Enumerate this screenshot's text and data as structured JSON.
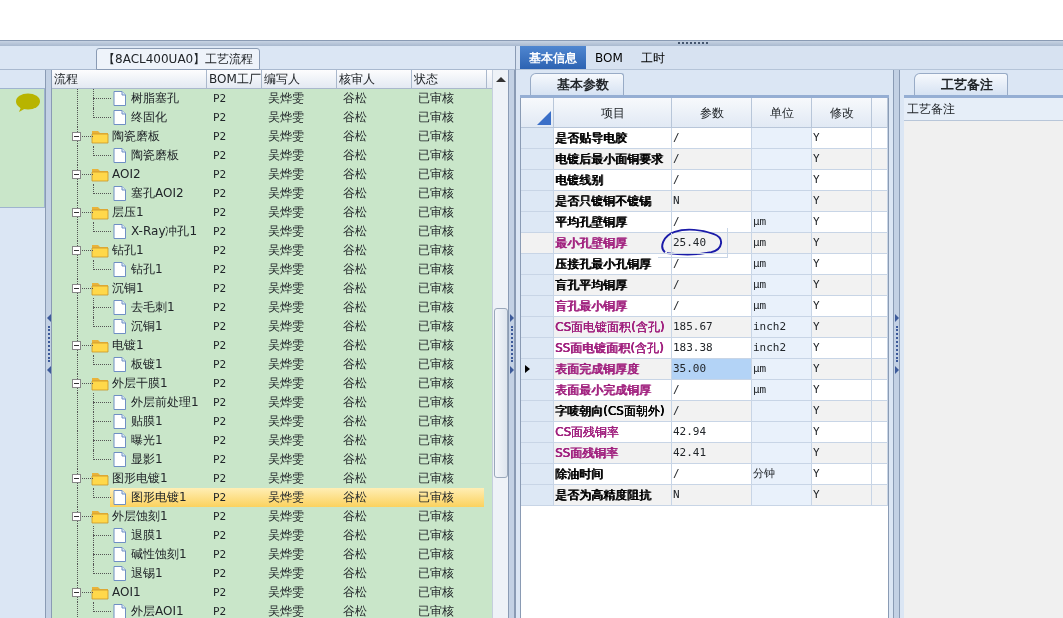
{
  "left_panel": {
    "title": "【8ACL400UA0】工艺流程",
    "columns": [
      "流程",
      "BOM工厂",
      "编写人",
      "核审人",
      "状态"
    ],
    "tree": [
      {
        "children": [
          {
            "name": "树脂塞孔",
            "factory": "P2",
            "author": "吴烨雯",
            "reviewer": "谷松",
            "status": "已审核",
            "selected": false
          },
          {
            "name": "终固化",
            "factory": "P2",
            "author": "吴烨雯",
            "reviewer": "谷松",
            "status": "已审核",
            "selected": false
          }
        ]
      },
      {
        "name": "陶瓷磨板",
        "factory": "P2",
        "author": "吴烨雯",
        "reviewer": "谷松",
        "status": "已审核",
        "selected": false,
        "expanded": true,
        "children": [
          {
            "name": "陶瓷磨板",
            "factory": "P2",
            "author": "吴烨雯",
            "reviewer": "谷松",
            "status": "已审核",
            "selected": false
          }
        ]
      },
      {
        "name": "AOI2",
        "factory": "P2",
        "author": "吴烨雯",
        "reviewer": "谷松",
        "status": "已审核",
        "selected": false,
        "expanded": true,
        "children": [
          {
            "name": "塞孔AOI2",
            "factory": "P2",
            "author": "吴烨雯",
            "reviewer": "谷松",
            "status": "已审核",
            "selected": false
          }
        ]
      },
      {
        "name": "层压1",
        "factory": "P2",
        "author": "吴烨雯",
        "reviewer": "谷松",
        "status": "已审核",
        "selected": false,
        "expanded": true,
        "children": [
          {
            "name": "X-Ray冲孔1",
            "factory": "P2",
            "author": "吴烨雯",
            "reviewer": "谷松",
            "status": "已审核",
            "selected": false
          }
        ]
      },
      {
        "name": "钻孔1",
        "factory": "P2",
        "author": "吴烨雯",
        "reviewer": "谷松",
        "status": "已审核",
        "selected": false,
        "expanded": true,
        "children": [
          {
            "name": "钻孔1",
            "factory": "P2",
            "author": "吴烨雯",
            "reviewer": "谷松",
            "status": "已审核",
            "selected": false
          }
        ]
      },
      {
        "name": "沉铜1",
        "factory": "P2",
        "author": "吴烨雯",
        "reviewer": "谷松",
        "status": "已审核",
        "selected": false,
        "expanded": true,
        "children": [
          {
            "name": "去毛刺1",
            "factory": "P2",
            "author": "吴烨雯",
            "reviewer": "谷松",
            "status": "已审核",
            "selected": false
          },
          {
            "name": "沉铜1",
            "factory": "P2",
            "author": "吴烨雯",
            "reviewer": "谷松",
            "status": "已审核",
            "selected": false
          }
        ]
      },
      {
        "name": "电镀1",
        "factory": "P2",
        "author": "吴烨雯",
        "reviewer": "谷松",
        "status": "已审核",
        "selected": false,
        "expanded": true,
        "children": [
          {
            "name": "板镀1",
            "factory": "P2",
            "author": "吴烨雯",
            "reviewer": "谷松",
            "status": "已审核",
            "selected": false
          }
        ]
      },
      {
        "name": "外层干膜1",
        "factory": "P2",
        "author": "吴烨雯",
        "reviewer": "谷松",
        "status": "已审核",
        "selected": false,
        "expanded": true,
        "children": [
          {
            "name": "外层前处理1",
            "factory": "P2",
            "author": "吴烨雯",
            "reviewer": "谷松",
            "status": "已审核",
            "selected": false
          },
          {
            "name": "贴膜1",
            "factory": "P2",
            "author": "吴烨雯",
            "reviewer": "谷松",
            "status": "已审核",
            "selected": false
          },
          {
            "name": "曝光1",
            "factory": "P2",
            "author": "吴烨雯",
            "reviewer": "谷松",
            "status": "已审核",
            "selected": false
          },
          {
            "name": "显影1",
            "factory": "P2",
            "author": "吴烨雯",
            "reviewer": "谷松",
            "status": "已审核",
            "selected": false
          }
        ]
      },
      {
        "name": "图形电镀1",
        "factory": "P2",
        "author": "吴烨雯",
        "reviewer": "谷松",
        "status": "已审核",
        "selected": false,
        "expanded": true,
        "children": [
          {
            "name": "图形电镀1",
            "factory": "P2",
            "author": "吴烨雯",
            "reviewer": "谷松",
            "status": "已审核",
            "selected": true
          }
        ]
      },
      {
        "name": "外层蚀刻1",
        "factory": "P2",
        "author": "吴烨雯",
        "reviewer": "谷松",
        "status": "已审核",
        "selected": false,
        "expanded": true,
        "children": [
          {
            "name": "退膜1",
            "factory": "P2",
            "author": "吴烨雯",
            "reviewer": "谷松",
            "status": "已审核",
            "selected": false
          },
          {
            "name": "碱性蚀刻1",
            "factory": "P2",
            "author": "吴烨雯",
            "reviewer": "谷松",
            "status": "已审核",
            "selected": false
          },
          {
            "name": "退锡1",
            "factory": "P2",
            "author": "吴烨雯",
            "reviewer": "谷松",
            "status": "已审核",
            "selected": false
          }
        ]
      },
      {
        "name": "AOI1",
        "factory": "P2",
        "author": "吴烨雯",
        "reviewer": "谷松",
        "status": "已审核",
        "selected": false,
        "expanded": true,
        "children": [
          {
            "name": "外层AOI1",
            "factory": "P2",
            "author": "吴烨雯",
            "reviewer": "谷松",
            "status": "已审核",
            "selected": false
          }
        ]
      }
    ]
  },
  "tabs": [
    {
      "label": "基本信息",
      "selected": true
    },
    {
      "label": "BOM",
      "selected": false
    },
    {
      "label": "工时",
      "selected": false
    }
  ],
  "params": {
    "tab": "基本参数",
    "columns": [
      "项目",
      "参数",
      "单位",
      "修改"
    ],
    "rows": [
      {
        "item": "是否贴导电胶",
        "color": "#000000",
        "value": "/",
        "unit": "",
        "modify": "Y",
        "selected": false,
        "circled": false
      },
      {
        "item": "电镀后最小面铜要求",
        "color": "#000000",
        "value": "/",
        "unit": "",
        "modify": "Y",
        "selected": false,
        "circled": false
      },
      {
        "item": "电镀线别",
        "color": "#000000",
        "value": "/",
        "unit": "",
        "modify": "Y",
        "selected": false,
        "circled": false
      },
      {
        "item": "是否只镀铜不镀锡",
        "color": "#000000",
        "value": "N",
        "unit": "",
        "modify": "Y",
        "selected": false,
        "circled": false
      },
      {
        "item": "平均孔壁铜厚",
        "color": "#000000",
        "value": "/",
        "unit": "μm",
        "modify": "Y",
        "selected": false,
        "circled": false
      },
      {
        "item": "最小孔壁铜厚",
        "color": "#a0207e",
        "value": "25.40",
        "unit": "μm",
        "modify": "Y",
        "selected": false,
        "circled": true
      },
      {
        "item": "压接孔最小孔铜厚",
        "color": "#000000",
        "value": "/",
        "unit": "μm",
        "modify": "Y",
        "selected": false,
        "circled": false
      },
      {
        "item": "盲孔平均铜厚",
        "color": "#000000",
        "value": "/",
        "unit": "μm",
        "modify": "Y",
        "selected": false,
        "circled": false
      },
      {
        "item": "盲孔最小铜厚",
        "color": "#a0207e",
        "value": "/",
        "unit": "μm",
        "modify": "Y",
        "selected": false,
        "circled": false
      },
      {
        "item": "CS面电镀面积(含孔)",
        "color": "#a0207e",
        "value": "185.67",
        "unit": "inch2",
        "modify": "Y",
        "selected": false,
        "circled": false
      },
      {
        "item": "SS面电镀面积(含孔)",
        "color": "#a0207e",
        "value": "183.38",
        "unit": "inch2",
        "modify": "Y",
        "selected": false,
        "circled": false
      },
      {
        "item": "表面完成铜厚度",
        "color": "#a0207e",
        "value": "35.00",
        "unit": "μm",
        "modify": "Y",
        "selected": true,
        "circled": false
      },
      {
        "item": "表面最小完成铜厚",
        "color": "#a0207e",
        "value": "/",
        "unit": "μm",
        "modify": "Y",
        "selected": false,
        "circled": false
      },
      {
        "item": "字唛朝向(CS面朝外)",
        "color": "#000000",
        "value": "/",
        "unit": "",
        "modify": "Y",
        "selected": false,
        "circled": false
      },
      {
        "item": "CS面残铜率",
        "color": "#a0207e",
        "value": "42.94",
        "unit": "",
        "modify": "Y",
        "selected": false,
        "circled": false
      },
      {
        "item": "SS面残铜率",
        "color": "#a0207e",
        "value": "42.41",
        "unit": "",
        "modify": "Y",
        "selected": false,
        "circled": false
      },
      {
        "item": "除油时间",
        "color": "#000000",
        "value": "/",
        "unit": "分钟",
        "modify": "Y",
        "selected": false,
        "circled": false
      },
      {
        "item": "是否为高精度阻抗",
        "color": "#000000",
        "value": "N",
        "unit": "",
        "modify": "Y",
        "selected": false,
        "circled": false
      }
    ]
  },
  "notes": {
    "tab": "工艺备注",
    "label": "工艺备注"
  }
}
